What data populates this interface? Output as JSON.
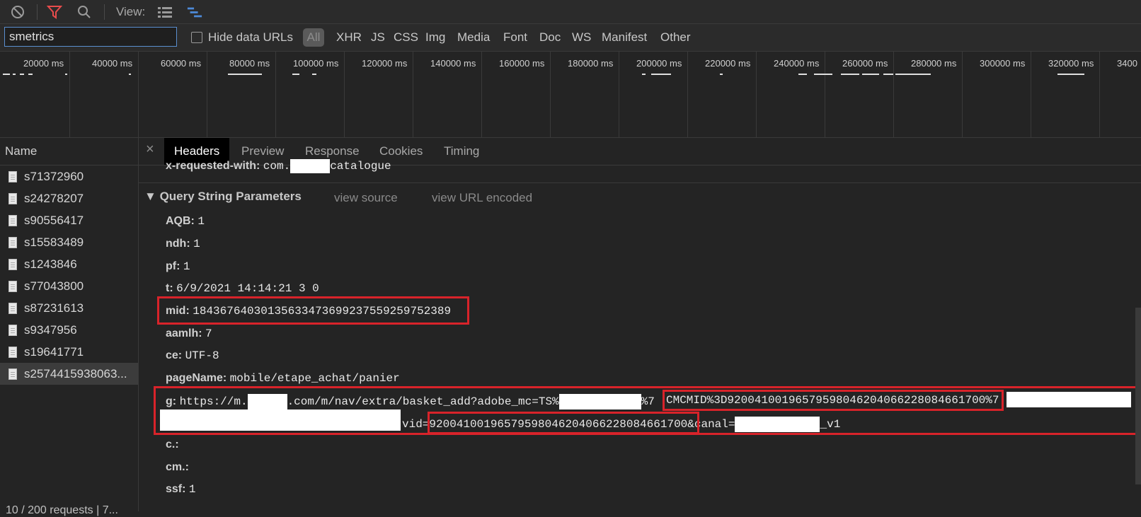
{
  "toolbar": {
    "view_label": "View:"
  },
  "filter": {
    "value": "smetrics",
    "hide_data_urls": "Hide data URLs",
    "types": [
      "All",
      "XHR",
      "JS",
      "CSS",
      "Img",
      "Media",
      "Font",
      "Doc",
      "WS",
      "Manifest",
      "Other"
    ]
  },
  "timeline": {
    "ticks": [
      "20000 ms",
      "40000 ms",
      "60000 ms",
      "80000 ms",
      "100000 ms",
      "120000 ms",
      "140000 ms",
      "160000 ms",
      "180000 ms",
      "200000 ms",
      "220000 ms",
      "240000 ms",
      "260000 ms",
      "280000 ms",
      "300000 ms",
      "320000 ms",
      "3400"
    ]
  },
  "requests": {
    "header": "Name",
    "items": [
      "s71372960",
      "s24278207",
      "s90556417",
      "s15583489",
      "s1243846",
      "s77043800",
      "s87231613",
      "s9347956",
      "s19641771",
      "s2574415938063..."
    ],
    "status": "10 / 200 requests | 7..."
  },
  "tabs": {
    "close": "×",
    "items": [
      "Headers",
      "Preview",
      "Response",
      "Cookies",
      "Timing"
    ]
  },
  "headers": {
    "xrw_key": "x-requested-with:",
    "xrw_val_a": "com.",
    "xrw_val_b": "catalogue",
    "section": "Query String Parameters",
    "view_source": "view source",
    "view_url_encoded": "view URL encoded",
    "params": [
      {
        "k": "AQB:",
        "v": "1"
      },
      {
        "k": "ndh:",
        "v": "1"
      },
      {
        "k": "pf:",
        "v": "1"
      },
      {
        "k": "t:",
        "v": "6/9/2021 14:14:21 3 0"
      },
      {
        "k": "mid:",
        "v": "18436764030135633473699237559259752389"
      },
      {
        "k": "aamlh:",
        "v": "7"
      },
      {
        "k": "ce:",
        "v": "UTF-8"
      },
      {
        "k": "pageName:",
        "v": "mobile/etape_achat/panier"
      }
    ],
    "g_key": "g:",
    "g_part1": "https://m.",
    "g_part2": ".com/m/nav/extra/basket_add?adobe_mc=TS%",
    "g_part3": "%7",
    "g_mcmid": "CMCMID%3D92004100196579598046204066228084661700%7",
    "g_part4": "vid=",
    "g_vid": "92004100196579598046204066228084661700&",
    "g_part5": "canal=",
    "g_part6": "_v1",
    "tail": [
      {
        "k": "c.:",
        "v": ""
      },
      {
        "k": "cm.:",
        "v": ""
      },
      {
        "k": "ssf:",
        "v": "1"
      }
    ]
  }
}
